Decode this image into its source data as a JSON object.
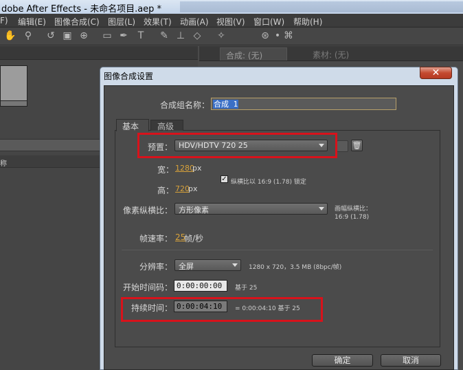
{
  "window": {
    "title": "dobe After Effects - 未命名项目.aep *"
  },
  "menu": [
    "F)",
    "编辑(E)",
    "图像合成(C)",
    "图层(L)",
    "效果(T)",
    "动画(A)",
    "视图(V)",
    "窗口(W)",
    "帮助(H)"
  ],
  "left_panel": {
    "column_label": "称"
  },
  "viewer_tabs": {
    "composition": "合成: (无)",
    "footage": "素材: (无)"
  },
  "dialog": {
    "title": "图像合成设置",
    "close_symbol": "✕",
    "comp_name_label": "合成组名称：",
    "comp_name_value": "合成 1",
    "tabs": {
      "basic": "基本",
      "advanced": "高级"
    },
    "preset_label": "预置：",
    "preset_value": "HDV/HDTV 720 25",
    "width_label": "宽：",
    "width_value": "1280",
    "width_unit": "px",
    "height_label": "高：",
    "height_value": "720",
    "height_unit": "px",
    "lock_aspect_label": "纵横比以 16:9 (1.78) 锁定",
    "lock_aspect_checked": true,
    "pixel_aspect_label": "像素纵横比：",
    "pixel_aspect_value": "方形像素",
    "frame_aspect_label": "画幅纵横比：",
    "frame_aspect_value": "16:9 (1.78)",
    "frame_rate_label": "帧速率：",
    "frame_rate_value": "25",
    "frame_rate_unit": "帧/秒",
    "resolution_label": "分辨率：",
    "resolution_value": "全屏",
    "resolution_info": "1280 x 720，3.5 MB (8bpc/帧)",
    "start_tc_label": "开始时间码：",
    "start_tc_value": "0:00:00:00",
    "start_tc_base": "基于 25",
    "duration_label": "持续时间：",
    "duration_value": "0:00:04:10",
    "duration_info": "= 0:00:04:10  基于 25",
    "ok_label": "确定",
    "cancel_label": "取消"
  },
  "colors": {
    "highlight_box": "#d8121b",
    "value_orange": "#d8a23a"
  }
}
